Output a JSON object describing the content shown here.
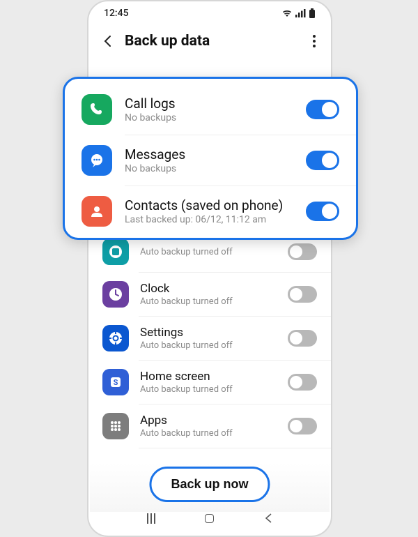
{
  "statusbar": {
    "time": "12:45"
  },
  "appbar": {
    "title": "Back up data"
  },
  "highlighted": [
    {
      "title": "Call logs",
      "sub": "No backups",
      "toggle": "on",
      "icon": "phone-icon",
      "bg": "bg-green"
    },
    {
      "title": "Messages",
      "sub": "No backups",
      "toggle": "on",
      "icon": "message-icon",
      "bg": "bg-blue"
    },
    {
      "title": "Contacts (saved on phone)",
      "sub": "Last backed up: 06/12, 11:12 am",
      "toggle": "on",
      "icon": "contact-icon",
      "bg": "bg-red"
    }
  ],
  "items": [
    {
      "title": "",
      "sub": "Auto backup turned off",
      "toggle": "off",
      "icon": "calendar-icon",
      "bg": "bg-teal",
      "partial": true
    },
    {
      "title": "Clock",
      "sub": "Auto backup turned off",
      "toggle": "off",
      "icon": "clock-icon",
      "bg": "bg-purple"
    },
    {
      "title": "Settings",
      "sub": "Auto backup turned off",
      "toggle": "off",
      "icon": "settings-icon",
      "bg": "bg-darkblue"
    },
    {
      "title": "Home screen",
      "sub": "Auto backup turned off",
      "toggle": "off",
      "icon": "home-icon",
      "bg": "bg-royal"
    },
    {
      "title": "Apps",
      "sub": "Auto backup turned off",
      "toggle": "off",
      "icon": "apps-icon",
      "bg": "bg-grey"
    }
  ],
  "backup_button": "Back up now"
}
